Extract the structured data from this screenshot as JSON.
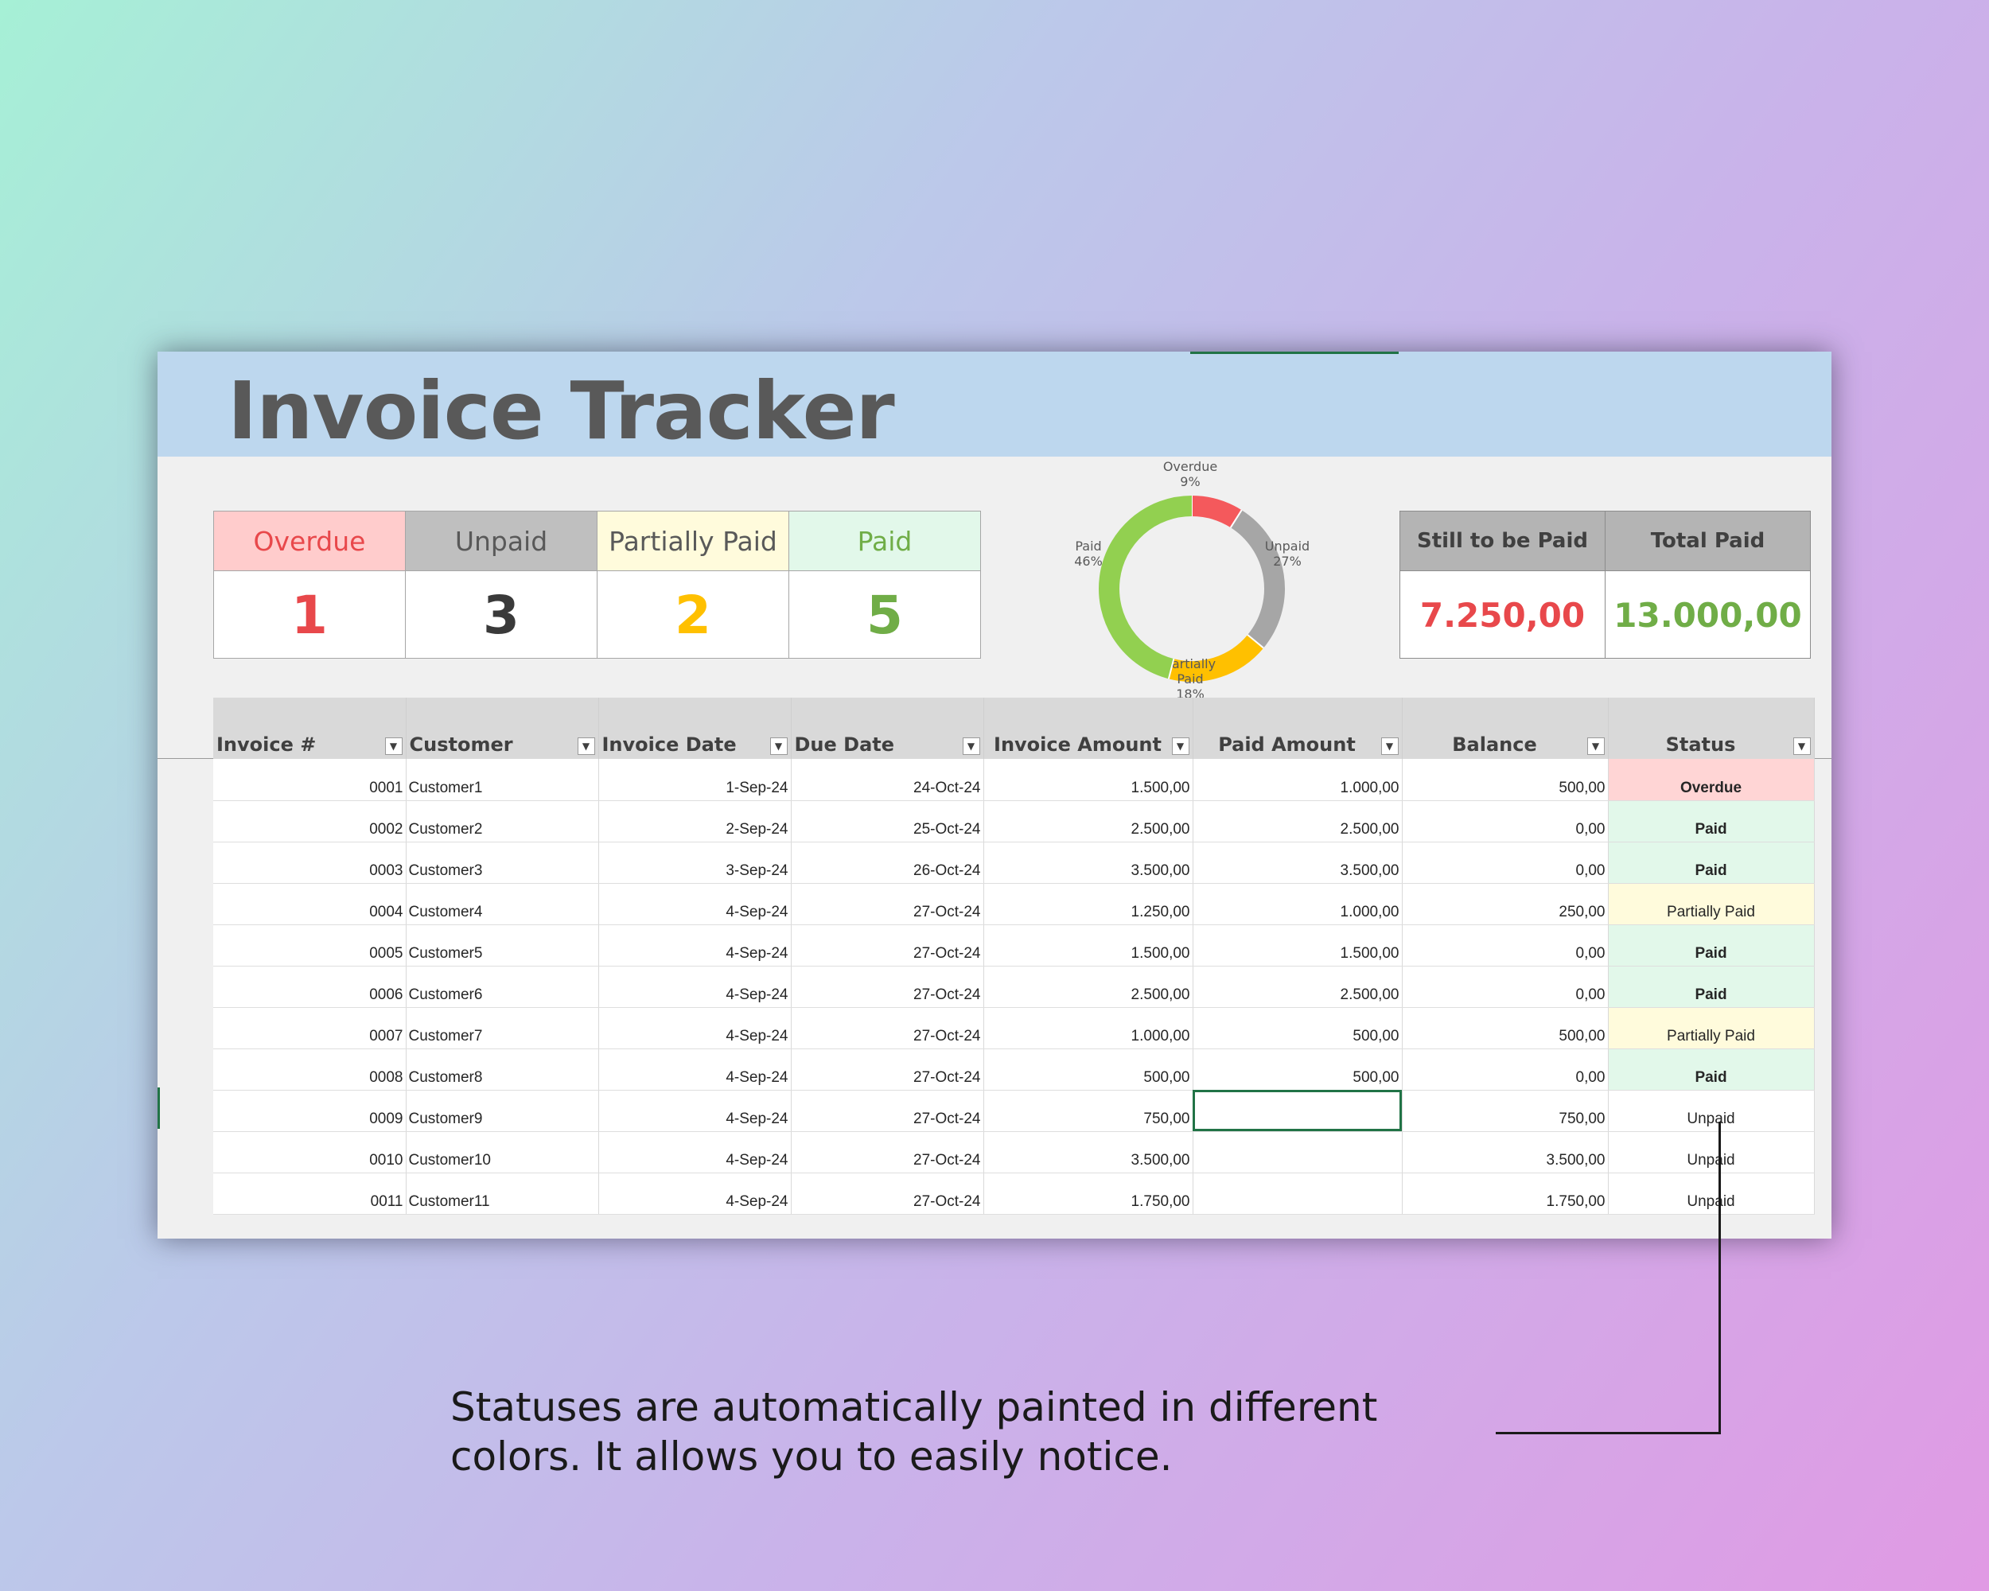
{
  "title": "Invoice Tracker",
  "colors": {
    "overdue": "#e8484b",
    "unpaid": "#3a3a3a",
    "partial": "#ffc000",
    "paid": "#70ad47",
    "balance": "#4472c4",
    "accent": "#217346"
  },
  "status_cards": [
    {
      "label": "Overdue",
      "value": "1"
    },
    {
      "label": "Unpaid",
      "value": "3"
    },
    {
      "label": "Partially Paid",
      "value": "2"
    },
    {
      "label": "Paid",
      "value": "5"
    }
  ],
  "totals": [
    {
      "label": "Still to be Paid",
      "value": "7.250,00"
    },
    {
      "label": "Total Paid",
      "value": "13.000,00"
    }
  ],
  "chart_data": {
    "type": "pie",
    "subtype": "doughnut",
    "slices": [
      {
        "label": "Overdue",
        "percent": 9,
        "pct_label": "9%",
        "color": "#f4595c"
      },
      {
        "label": "Unpaid",
        "percent": 27,
        "pct_label": "27%",
        "color": "#a6a6a6"
      },
      {
        "label": "Partially Paid",
        "percent": 18,
        "pct_label": "18%",
        "color": "#ffc000"
      },
      {
        "label": "Paid",
        "percent": 46,
        "pct_label": "46%",
        "color": "#92d050"
      }
    ]
  },
  "table": {
    "headers": [
      "Invoice #",
      "Customer",
      "Invoice Date",
      "Due Date",
      "Invoice Amount",
      "Paid Amount",
      "Balance",
      "Status"
    ],
    "filter_icon": "dropdown-arrow-icon",
    "rows": [
      {
        "invoice": "0001",
        "customer": "Customer1",
        "invoice_date": "1-Sep-24",
        "due_date": "24-Oct-24",
        "amount": "1.500,00",
        "paid": "1.000,00",
        "balance": "500,00",
        "status": "Overdue"
      },
      {
        "invoice": "0002",
        "customer": "Customer2",
        "invoice_date": "2-Sep-24",
        "due_date": "25-Oct-24",
        "amount": "2.500,00",
        "paid": "2.500,00",
        "balance": "0,00",
        "status": "Paid"
      },
      {
        "invoice": "0003",
        "customer": "Customer3",
        "invoice_date": "3-Sep-24",
        "due_date": "26-Oct-24",
        "amount": "3.500,00",
        "paid": "3.500,00",
        "balance": "0,00",
        "status": "Paid"
      },
      {
        "invoice": "0004",
        "customer": "Customer4",
        "invoice_date": "4-Sep-24",
        "due_date": "27-Oct-24",
        "amount": "1.250,00",
        "paid": "1.000,00",
        "balance": "250,00",
        "status": "Partially Paid"
      },
      {
        "invoice": "0005",
        "customer": "Customer5",
        "invoice_date": "4-Sep-24",
        "due_date": "27-Oct-24",
        "amount": "1.500,00",
        "paid": "1.500,00",
        "balance": "0,00",
        "status": "Paid"
      },
      {
        "invoice": "0006",
        "customer": "Customer6",
        "invoice_date": "4-Sep-24",
        "due_date": "27-Oct-24",
        "amount": "2.500,00",
        "paid": "2.500,00",
        "balance": "0,00",
        "status": "Paid"
      },
      {
        "invoice": "0007",
        "customer": "Customer7",
        "invoice_date": "4-Sep-24",
        "due_date": "27-Oct-24",
        "amount": "1.000,00",
        "paid": "500,00",
        "balance": "500,00",
        "status": "Partially Paid"
      },
      {
        "invoice": "0008",
        "customer": "Customer8",
        "invoice_date": "4-Sep-24",
        "due_date": "27-Oct-24",
        "amount": "500,00",
        "paid": "500,00",
        "balance": "0,00",
        "status": "Paid"
      },
      {
        "invoice": "0009",
        "customer": "Customer9",
        "invoice_date": "4-Sep-24",
        "due_date": "27-Oct-24",
        "amount": "750,00",
        "paid": "",
        "balance": "750,00",
        "status": "Unpaid"
      },
      {
        "invoice": "0010",
        "customer": "Customer10",
        "invoice_date": "4-Sep-24",
        "due_date": "27-Oct-24",
        "amount": "3.500,00",
        "paid": "",
        "balance": "3.500,00",
        "status": "Unpaid"
      },
      {
        "invoice": "0011",
        "customer": "Customer11",
        "invoice_date": "4-Sep-24",
        "due_date": "27-Oct-24",
        "amount": "1.750,00",
        "paid": "",
        "balance": "1.750,00",
        "status": "Unpaid"
      }
    ]
  },
  "caption": "Statuses are automatically painted in different colors. It allows you to easily notice."
}
